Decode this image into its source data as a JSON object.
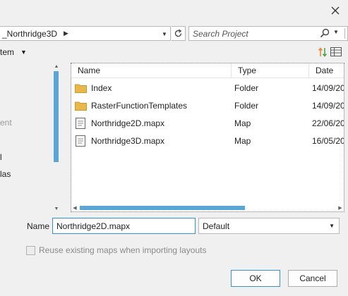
{
  "toolbar": {
    "path_segment": "_Northridge3D",
    "search_placeholder": "Search Project",
    "new_item_label": "tem"
  },
  "nav": {
    "items": [
      {
        "label": "ent",
        "disabled": true
      },
      {
        "label": "l",
        "disabled": false
      },
      {
        "label": "las",
        "disabled": false
      }
    ]
  },
  "columns": [
    "Name",
    "Type",
    "Date"
  ],
  "files": [
    {
      "name": "Index",
      "type": "Folder",
      "date": "14/09/20",
      "icon": "folder-icon"
    },
    {
      "name": "RasterFunctionTemplates",
      "type": "Folder",
      "date": "14/09/20",
      "icon": "folder-icon"
    },
    {
      "name": "Northridge2D.mapx",
      "type": "Map",
      "date": "22/06/20",
      "icon": "map-file-icon"
    },
    {
      "name": "Northridge3D.mapx",
      "type": "Map",
      "date": "16/05/20",
      "icon": "map-file-icon"
    }
  ],
  "form": {
    "name_label": "Name",
    "name_value": "Northridge2D.mapx",
    "filter_value": "Default",
    "reuse_label": "Reuse existing maps when importing layouts",
    "reuse_checked": false
  },
  "buttons": {
    "ok": "OK",
    "cancel": "Cancel"
  },
  "colors": {
    "accent": "#3b8fd1",
    "scroll_thumb": "#5aa6d6",
    "folder": "#e8b84a",
    "sort_icon_up": "#e8873a",
    "sort_icon_down": "#4aa84a"
  }
}
